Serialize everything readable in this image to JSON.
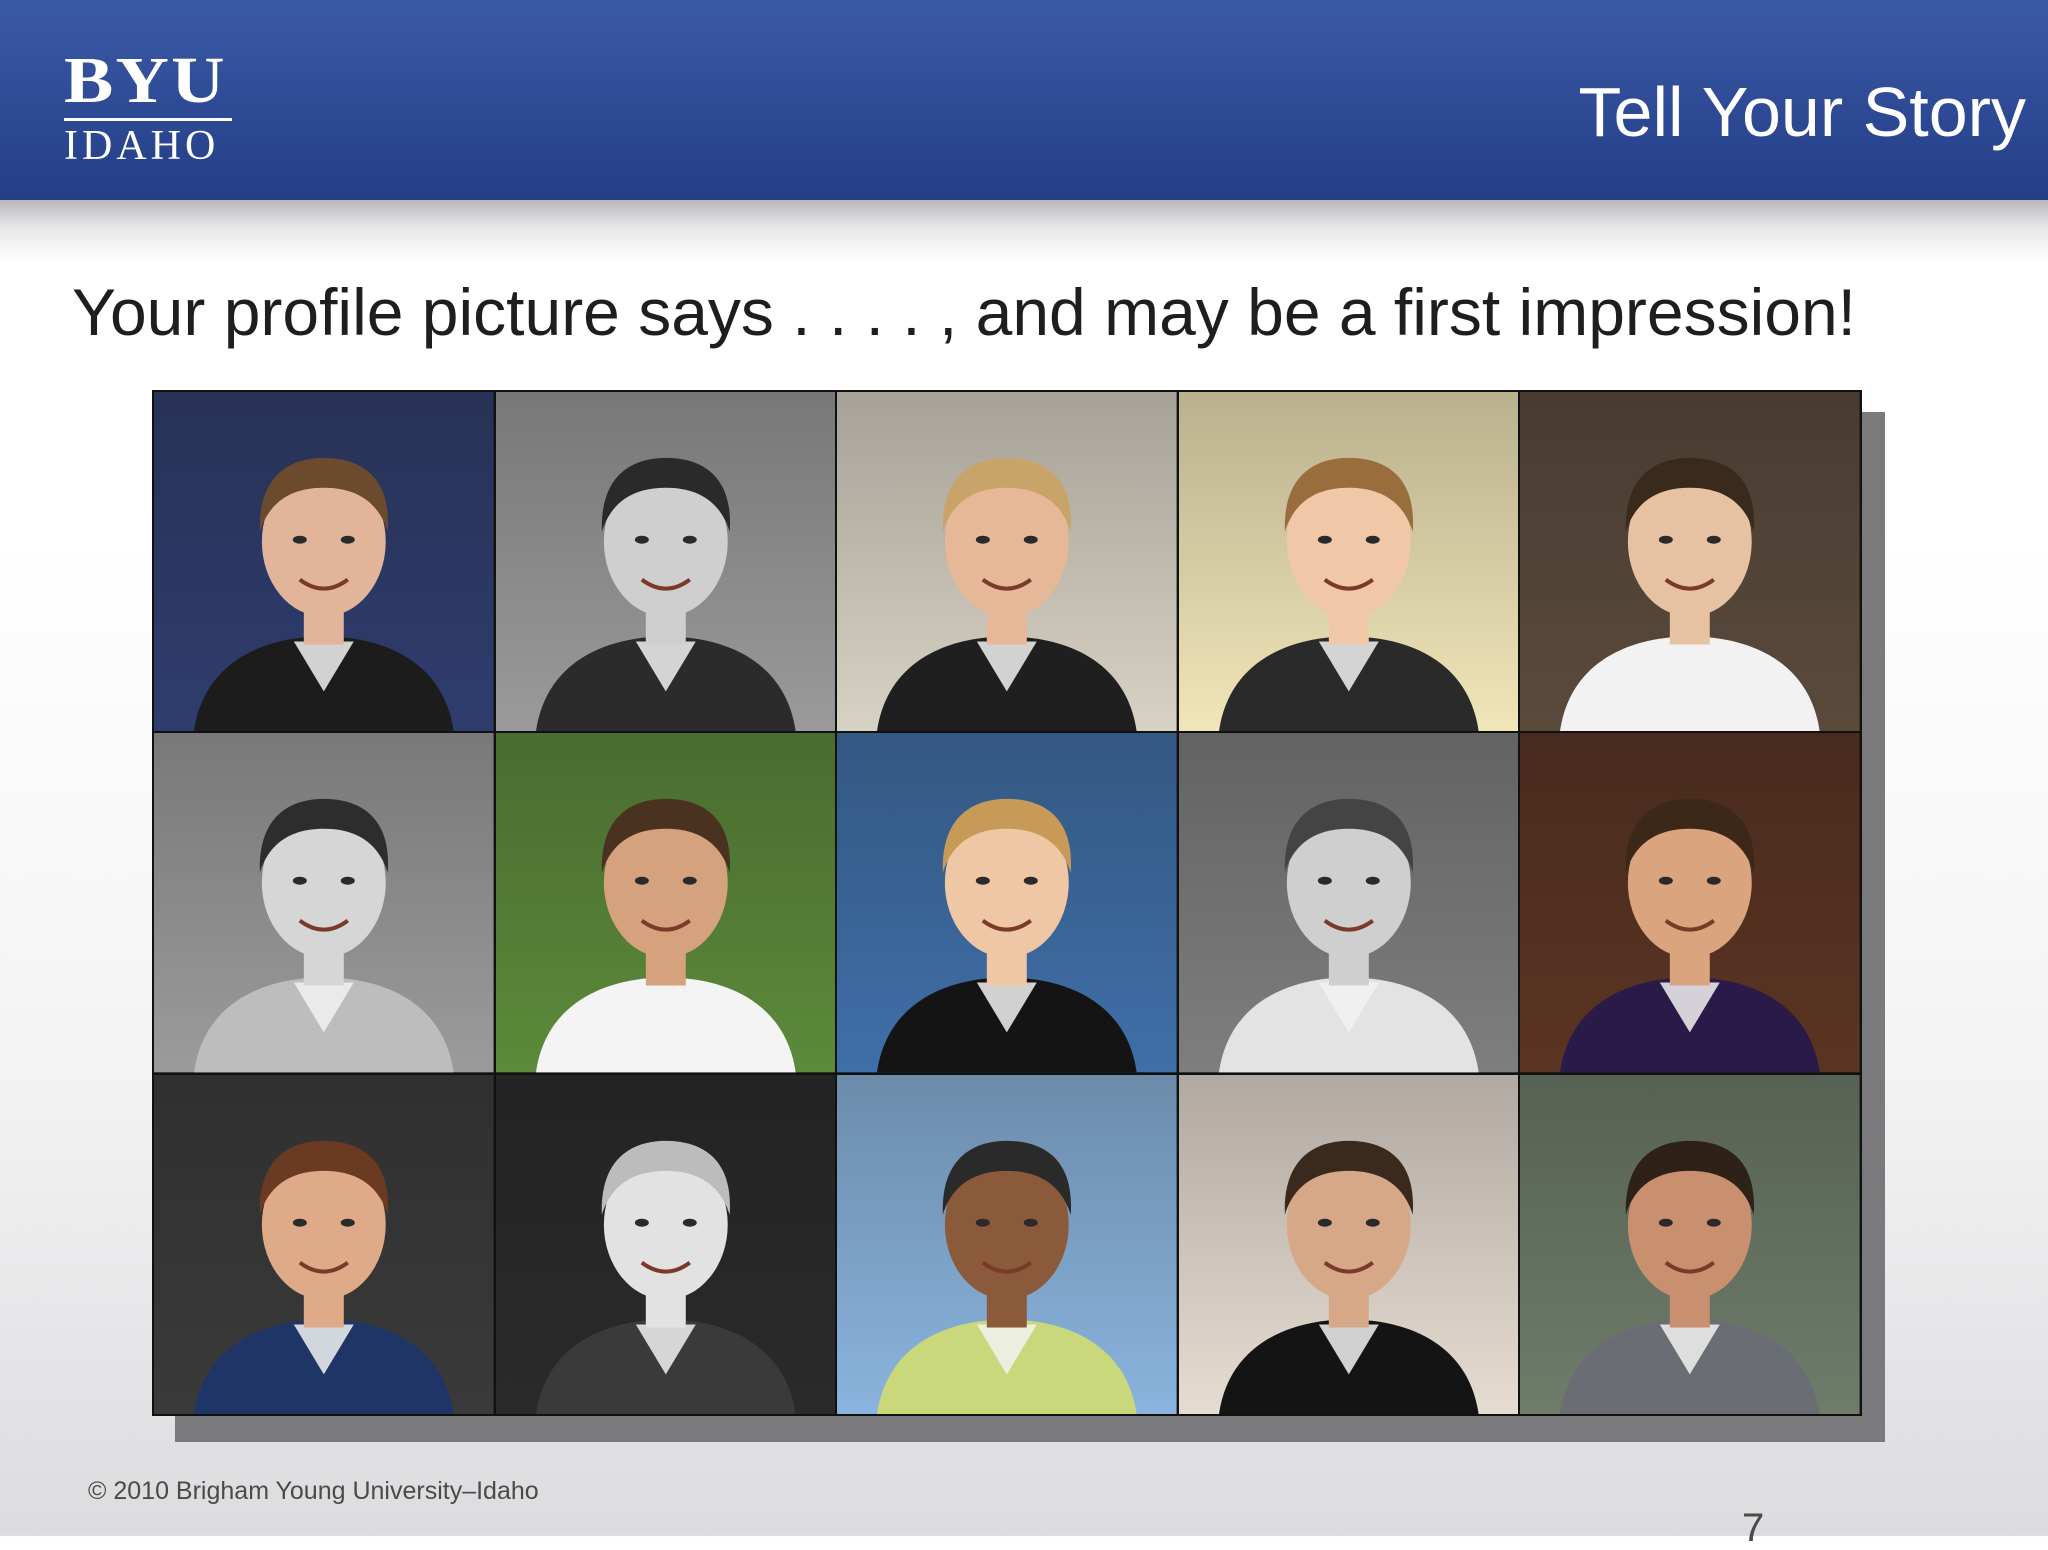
{
  "header": {
    "logo": {
      "line1": "BYU",
      "line2": "IDAHO"
    },
    "title": "Tell Your Story"
  },
  "subtitle": "Your profile picture says . . . . , and may be a first impression!",
  "photos": [
    {
      "name": "photo-man-flag-backdrop",
      "palette": {
        "bg": "#2f3d6e",
        "skin": "#e2b49a",
        "hair": "#6b4a2e",
        "shirt": "#1c1c1c"
      }
    },
    {
      "name": "photo-man-suit-bw",
      "palette": {
        "bg": "#9a9a9a",
        "skin": "#cfcfcf",
        "hair": "#2a2a2a",
        "shirt": "#2b2b2b"
      }
    },
    {
      "name": "photo-man-glasses-smiling",
      "palette": {
        "bg": "#d8d2c4",
        "skin": "#e6b898",
        "hair": "#c9a46a",
        "shirt": "#1f1f1f"
      }
    },
    {
      "name": "photo-woman-long-hair",
      "palette": {
        "bg": "#f1e6b8",
        "skin": "#f0c8a8",
        "hair": "#9a6e3c",
        "shirt": "#2a2a2a"
      }
    },
    {
      "name": "photo-man-with-elephant",
      "palette": {
        "bg": "#5a4a3c",
        "skin": "#e7c2a2",
        "hair": "#3a2a1c",
        "shirt": "#f2f2f2"
      }
    },
    {
      "name": "photo-couple-kiss-bw",
      "palette": {
        "bg": "#9b9b9b",
        "skin": "#d6d6d6",
        "hair": "#2d2d2d",
        "shirt": "#bdbdbd"
      }
    },
    {
      "name": "photo-missionaries-handshake",
      "palette": {
        "bg": "#5c8a3a",
        "skin": "#d6a27e",
        "hair": "#4a3220",
        "shirt": "#f4f4f4"
      }
    },
    {
      "name": "photo-cheerleader-pompoms",
      "palette": {
        "bg": "#3f6fa8",
        "skin": "#f0c7a5",
        "hair": "#c79a58",
        "shirt": "#141414"
      }
    },
    {
      "name": "photo-couple-field-bw",
      "palette": {
        "bg": "#7e7e7e",
        "skin": "#cfcfcf",
        "hair": "#444444",
        "shirt": "#e3e3e3"
      }
    },
    {
      "name": "photo-man-restaurant",
      "palette": {
        "bg": "#5a3422",
        "skin": "#d9a47e",
        "hair": "#3b2818",
        "shirt": "#2a1a48"
      }
    },
    {
      "name": "photo-man-blue-suit",
      "palette": {
        "bg": "#3a3a3a",
        "skin": "#deaa88",
        "hair": "#6a3a22",
        "shirt": "#1f3568"
      }
    },
    {
      "name": "photo-woman-blonde-bw",
      "palette": {
        "bg": "#2a2a2a",
        "skin": "#e2e2e2",
        "hair": "#bcbcbc",
        "shirt": "#3a3a3a"
      }
    },
    {
      "name": "photo-man-mountain-arms-raised",
      "palette": {
        "bg": "#8ab4de",
        "skin": "#8a5a3a",
        "hair": "#2a2a2a",
        "shirt": "#c9d87a"
      }
    },
    {
      "name": "photo-man-bow-tie",
      "palette": {
        "bg": "#e6dcd2",
        "skin": "#d7a888",
        "hair": "#3a2a1e",
        "shirt": "#141414"
      }
    },
    {
      "name": "photo-man-closeup-stubble",
      "palette": {
        "bg": "#6e7c6a",
        "skin": "#c99070",
        "hair": "#2e2218",
        "shirt": "#6a6e74"
      }
    }
  ],
  "footer": {
    "copyright": "© 2010 Brigham Young University–Idaho",
    "page_number": "7"
  }
}
